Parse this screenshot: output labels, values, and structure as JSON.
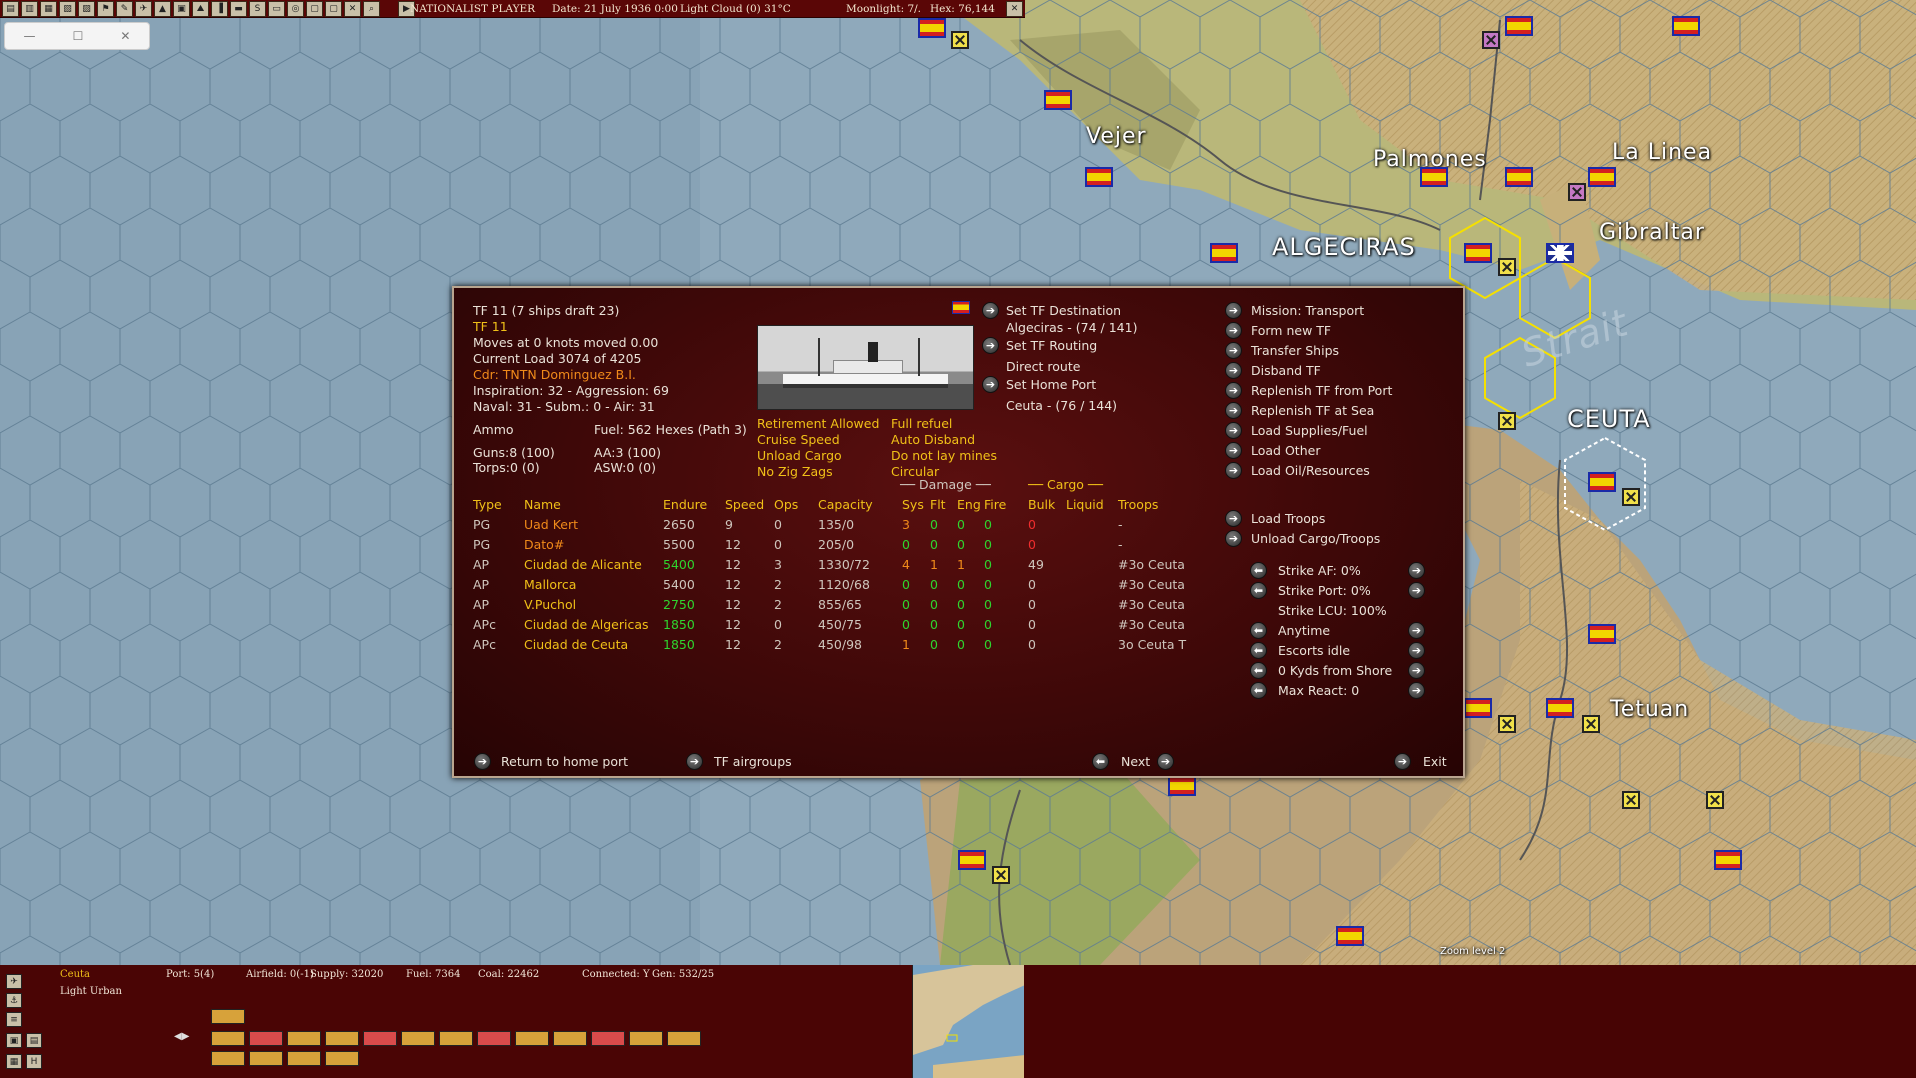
{
  "top_bar": {
    "player": "NATIONALIST PLAYER",
    "date": "Date: 21 July 1936 0:00",
    "weather": "Light Cloud (0) 31°C",
    "moonlight": "Moonlight: 7/.",
    "hex": "Hex: 76,144",
    "toolbar_icons": [
      "save-icon",
      "load-icon",
      "list-icon",
      "report-icon",
      "ships-icon",
      "flag-icon",
      "tools-icon",
      "air-icon",
      "ground-icon",
      "doc-icon",
      "mountain-icon",
      "bookmark-icon",
      "truck-icon",
      "s-icon",
      "map-icon",
      "target-icon",
      "cr-icon",
      "op-icon",
      "x-icon",
      "zoom-icon",
      "play-icon"
    ],
    "close_icon": "close-icon"
  },
  "window_controls": {
    "minimize": "—",
    "maximize": "☐",
    "close": "✕"
  },
  "map_labels": {
    "vejer": "Vejer",
    "palmones": "Palmones",
    "la_linea": "La Linea",
    "algeciras": "ALGECIRAS",
    "gibraltar": "Gibraltar",
    "strait": "Strait",
    "ceuta": "CEUTA",
    "tetuan": "Tetuan",
    "zoom_level": "Zoom level 2"
  },
  "dialog": {
    "tf_title": "TF 11 (7 ships draft 23)",
    "tf_name": "TF 11",
    "moves": "Moves at 0 knots moved 0.00",
    "load": "Current Load 3074 of 4205",
    "commander": "Cdr: TNTN Dominguez B.I.",
    "inspiration": "Inspiration: 32 - Aggression: 69",
    "skills": "Naval: 31 - Subm.: 0 - Air: 31",
    "ammo": "Ammo",
    "fuel": "Fuel: 562 Hexes (Path 3)",
    "guns": "Guns:8 (100)",
    "aa": "AA:3 (100)",
    "torps": "Torps:0 (0)",
    "asw": "ASW:0 (0)",
    "toggles_left": [
      "Retirement Allowed",
      "Cruise Speed",
      "Unload Cargo",
      "No Zig Zags"
    ],
    "toggles_right": [
      "Full refuel",
      "Auto Disband",
      "Do not lay mines",
      "Circular"
    ],
    "destination": {
      "set_dest": "Set TF Destination",
      "dest_value": "Algeciras - (74 / 141)",
      "set_routing": "Set TF Routing",
      "routing_value": "Direct route",
      "set_home": "Set Home Port",
      "home_value": "Ceuta - (76 / 144)"
    },
    "actions": [
      "Mission: Transport",
      "Form new TF",
      "Transfer Ships",
      "Disband TF",
      "Replenish TF from Port",
      "Replenish TF at Sea",
      "Load Supplies/Fuel",
      "Load Other",
      "Load Oil/Resources"
    ],
    "troop_actions": [
      "Load Troops",
      "Unload Cargo/Troops"
    ],
    "strike": [
      "Strike AF: 0%",
      "Strike Port: 0%",
      "Strike LCU: 100%",
      "Anytime",
      "Escorts idle",
      "0 Kyds from Shore",
      "Max React: 0"
    ],
    "group_damage": "Damage",
    "group_cargo": "Cargo",
    "columns": [
      "Type",
      "Name",
      "Endure",
      "Speed",
      "Ops",
      "Capacity",
      "Sys",
      "Flt",
      "Eng",
      "Fire",
      "Bulk",
      "Liquid",
      "Troops"
    ],
    "ships": [
      {
        "type": "PG",
        "name": "Uad Kert",
        "endure": "2650",
        "speed": "9",
        "ops": "0",
        "capacity": "135/0",
        "sys": "3",
        "flt": "0",
        "eng": "0",
        "fire": "0",
        "bulk": "0",
        "liquid": "",
        "troops": "-"
      },
      {
        "type": "PG",
        "name": "Dato#",
        "endure": "5500",
        "speed": "12",
        "ops": "0",
        "capacity": "205/0",
        "sys": "0",
        "flt": "0",
        "eng": "0",
        "fire": "0",
        "bulk": "0",
        "liquid": "",
        "troops": "-"
      },
      {
        "type": "AP",
        "name": "Ciudad de Alicante",
        "endure": "5400",
        "speed": "12",
        "ops": "3",
        "capacity": "1330/72",
        "sys": "4",
        "flt": "1",
        "eng": "1",
        "fire": "0",
        "bulk": "49",
        "liquid": "",
        "troops": "#3o Ceuta"
      },
      {
        "type": "AP",
        "name": "Mallorca",
        "endure": "5400",
        "speed": "12",
        "ops": "2",
        "capacity": "1120/68",
        "sys": "0",
        "flt": "0",
        "eng": "0",
        "fire": "0",
        "bulk": "0",
        "liquid": "",
        "troops": "#3o Ceuta"
      },
      {
        "type": "AP",
        "name": "V.Puchol",
        "endure": "2750",
        "speed": "12",
        "ops": "2",
        "capacity": "855/65",
        "sys": "0",
        "flt": "0",
        "eng": "0",
        "fire": "0",
        "bulk": "0",
        "liquid": "",
        "troops": "#3o Ceuta"
      },
      {
        "type": "APc",
        "name": "Ciudad de Algericas",
        "endure": "1850",
        "speed": "12",
        "ops": "0",
        "capacity": "450/75",
        "sys": "0",
        "flt": "0",
        "eng": "0",
        "fire": "0",
        "bulk": "0",
        "liquid": "",
        "troops": "#3o Ceuta"
      },
      {
        "type": "APc",
        "name": "Ciudad de Ceuta",
        "endure": "1850",
        "speed": "12",
        "ops": "2",
        "capacity": "450/98",
        "sys": "1",
        "flt": "0",
        "eng": "0",
        "fire": "0",
        "bulk": "0",
        "liquid": "",
        "troops": "3o Ceuta T"
      }
    ],
    "footer": {
      "return_home": "Return to home port",
      "airgroups": "TF airgroups",
      "next": "Next",
      "exit": "Exit"
    }
  },
  "bottom_panel": {
    "location": "Ceuta",
    "terrain": "Light Urban",
    "port": "Port: 5(4)",
    "airfield": "Airfield: 0(-1)",
    "supply": "Supply: 32020",
    "fuel": "Fuel: 7364",
    "coal": "Coal: 22462",
    "connected": "Connected: Y",
    "gen": "Gen: 532/25"
  },
  "colors": {
    "panel_red": "#4a0505",
    "highlight_yellow": "#f0c018",
    "green": "#2fd52f",
    "red": "#f02d2d"
  }
}
